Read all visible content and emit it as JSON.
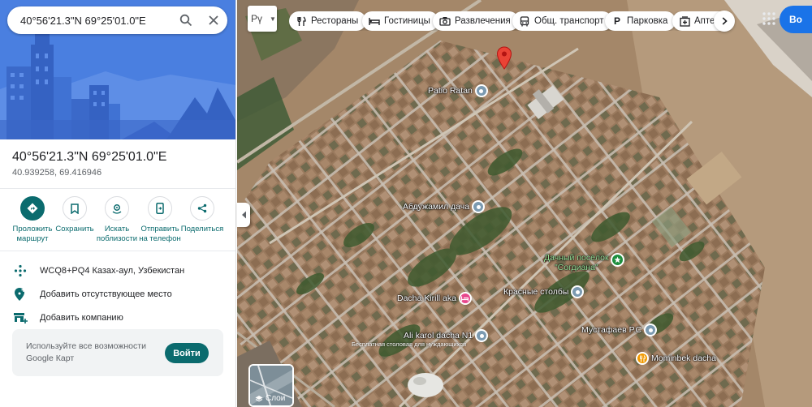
{
  "search": {
    "query": "40°56'21.3\"N 69°25'01.0\"E",
    "icons": [
      "search-icon",
      "close-icon"
    ]
  },
  "place": {
    "title": "40°56'21.3\"N 69°25'01.0\"E",
    "decimal": "40.939258, 69.416946"
  },
  "actions": [
    {
      "line1": "Проложить",
      "line2": "маршрут",
      "icon": "directions-icon"
    },
    {
      "line1": "Сохранить",
      "line2": "",
      "icon": "bookmark-icon"
    },
    {
      "line1": "Искать",
      "line2": "поблизости",
      "icon": "nearby-icon"
    },
    {
      "line1": "Отправить",
      "line2": "на телефон",
      "icon": "phone-icon"
    },
    {
      "line1": "Поделиться",
      "line2": "",
      "icon": "share-icon"
    }
  ],
  "info": {
    "plus_code": "WCQ8+PQ4 Казах-аул, Узбекистан",
    "add_missing": "Добавить отсутствующее место",
    "add_business": "Добавить компанию"
  },
  "promo": {
    "text": "Используйте все возможности Google Карт",
    "button": "Войти"
  },
  "map": {
    "lang": "Рү",
    "chips": [
      "Рестораны",
      "Гостиницы",
      "Развлечения",
      "Общ. транспорт",
      "Парковка",
      "Аптеки"
    ],
    "signin": "Во",
    "layers_label": "Слои",
    "pois": {
      "patio": "Patio Ratan",
      "abduzhamil": "Абдужамил дача",
      "dachny_1": "Дачный посёлок",
      "dachny_2": "\"Согдиана\"",
      "kirill": "Dacha Kirill aka",
      "stolby": "Красные столбы",
      "ali": "Ali karol dacha N1",
      "ali_sub": "Бесплатная столовая для нуждающихся",
      "mustafaev": "Мустафаев Р.С",
      "mominbek": "Mominbek dacha"
    }
  },
  "colors": {
    "accent": "#0b6b6e",
    "header_blue": "#4a7fe0",
    "marker_red": "#ea4335",
    "poi_gray": "#7b9ab1",
    "poi_pink": "#e8468c",
    "poi_green": "#1e8e3e",
    "poi_orange": "#f29900"
  }
}
